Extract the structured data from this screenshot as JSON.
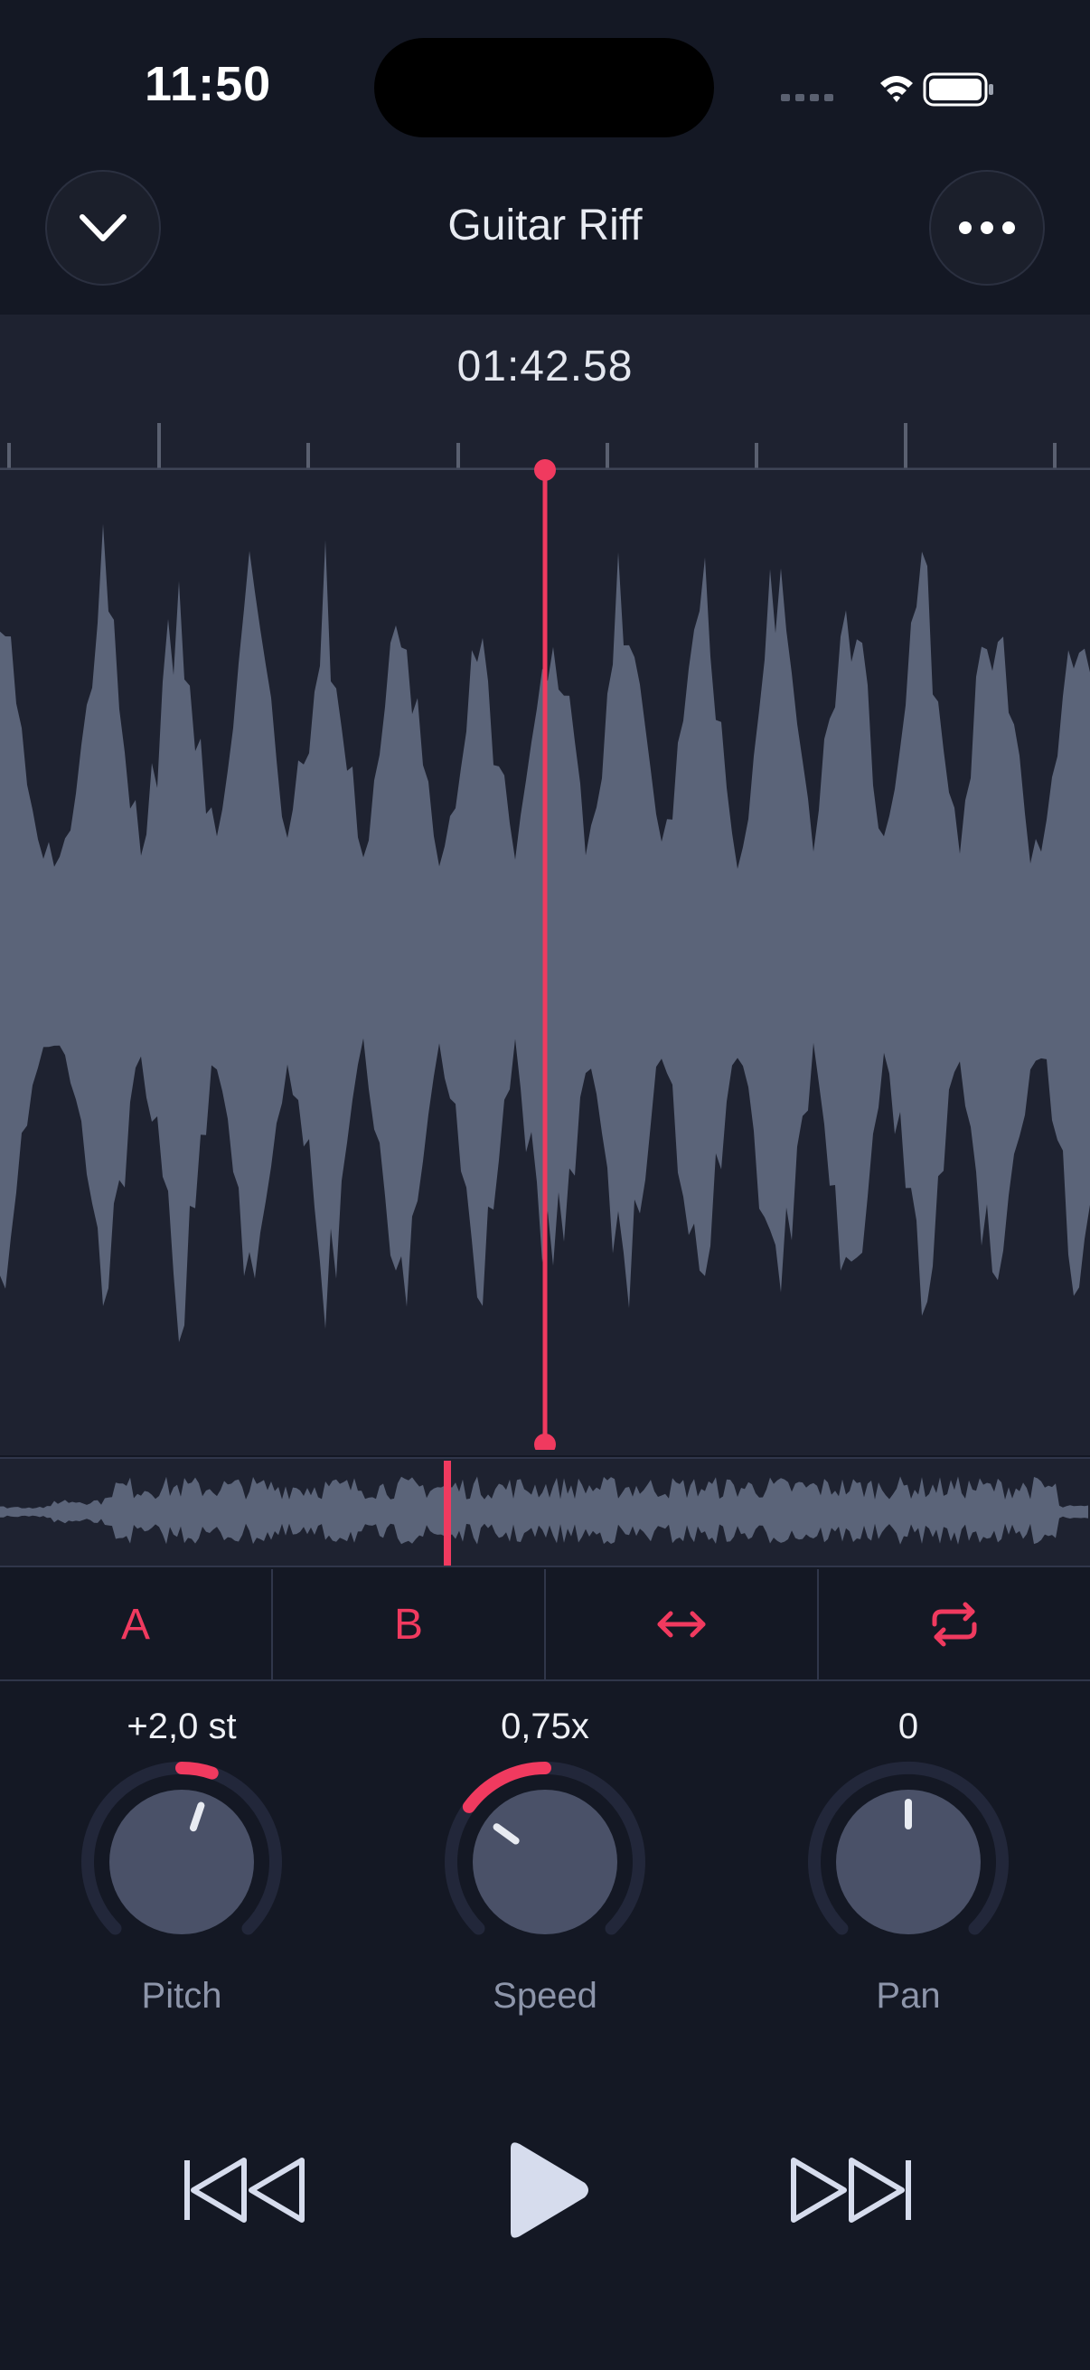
{
  "status": {
    "time": "11:50"
  },
  "header": {
    "title": "Guitar Riff"
  },
  "timeline": {
    "current_time": "01:42.58"
  },
  "ab_loop": {
    "a_label": "A",
    "b_label": "B"
  },
  "knobs": [
    {
      "value": "+2,0 st",
      "label": "Pitch",
      "level": 0.57
    },
    {
      "value": "0,75x",
      "label": "Speed",
      "level": 0.3
    },
    {
      "value": "0",
      "label": "Pan",
      "level": 0.5
    }
  ],
  "colors": {
    "accent": "#f03a5f",
    "background": "#141824",
    "waveform": "#5b6479",
    "panel": "#1e2230"
  },
  "icons": {
    "collapse": "chevron-down-icon",
    "more": "more-icon",
    "trim": "arrows-horizontal-icon",
    "loop": "repeat-icon",
    "rewind": "rewind-icon",
    "play": "play-icon",
    "forward": "fast-forward-icon"
  }
}
